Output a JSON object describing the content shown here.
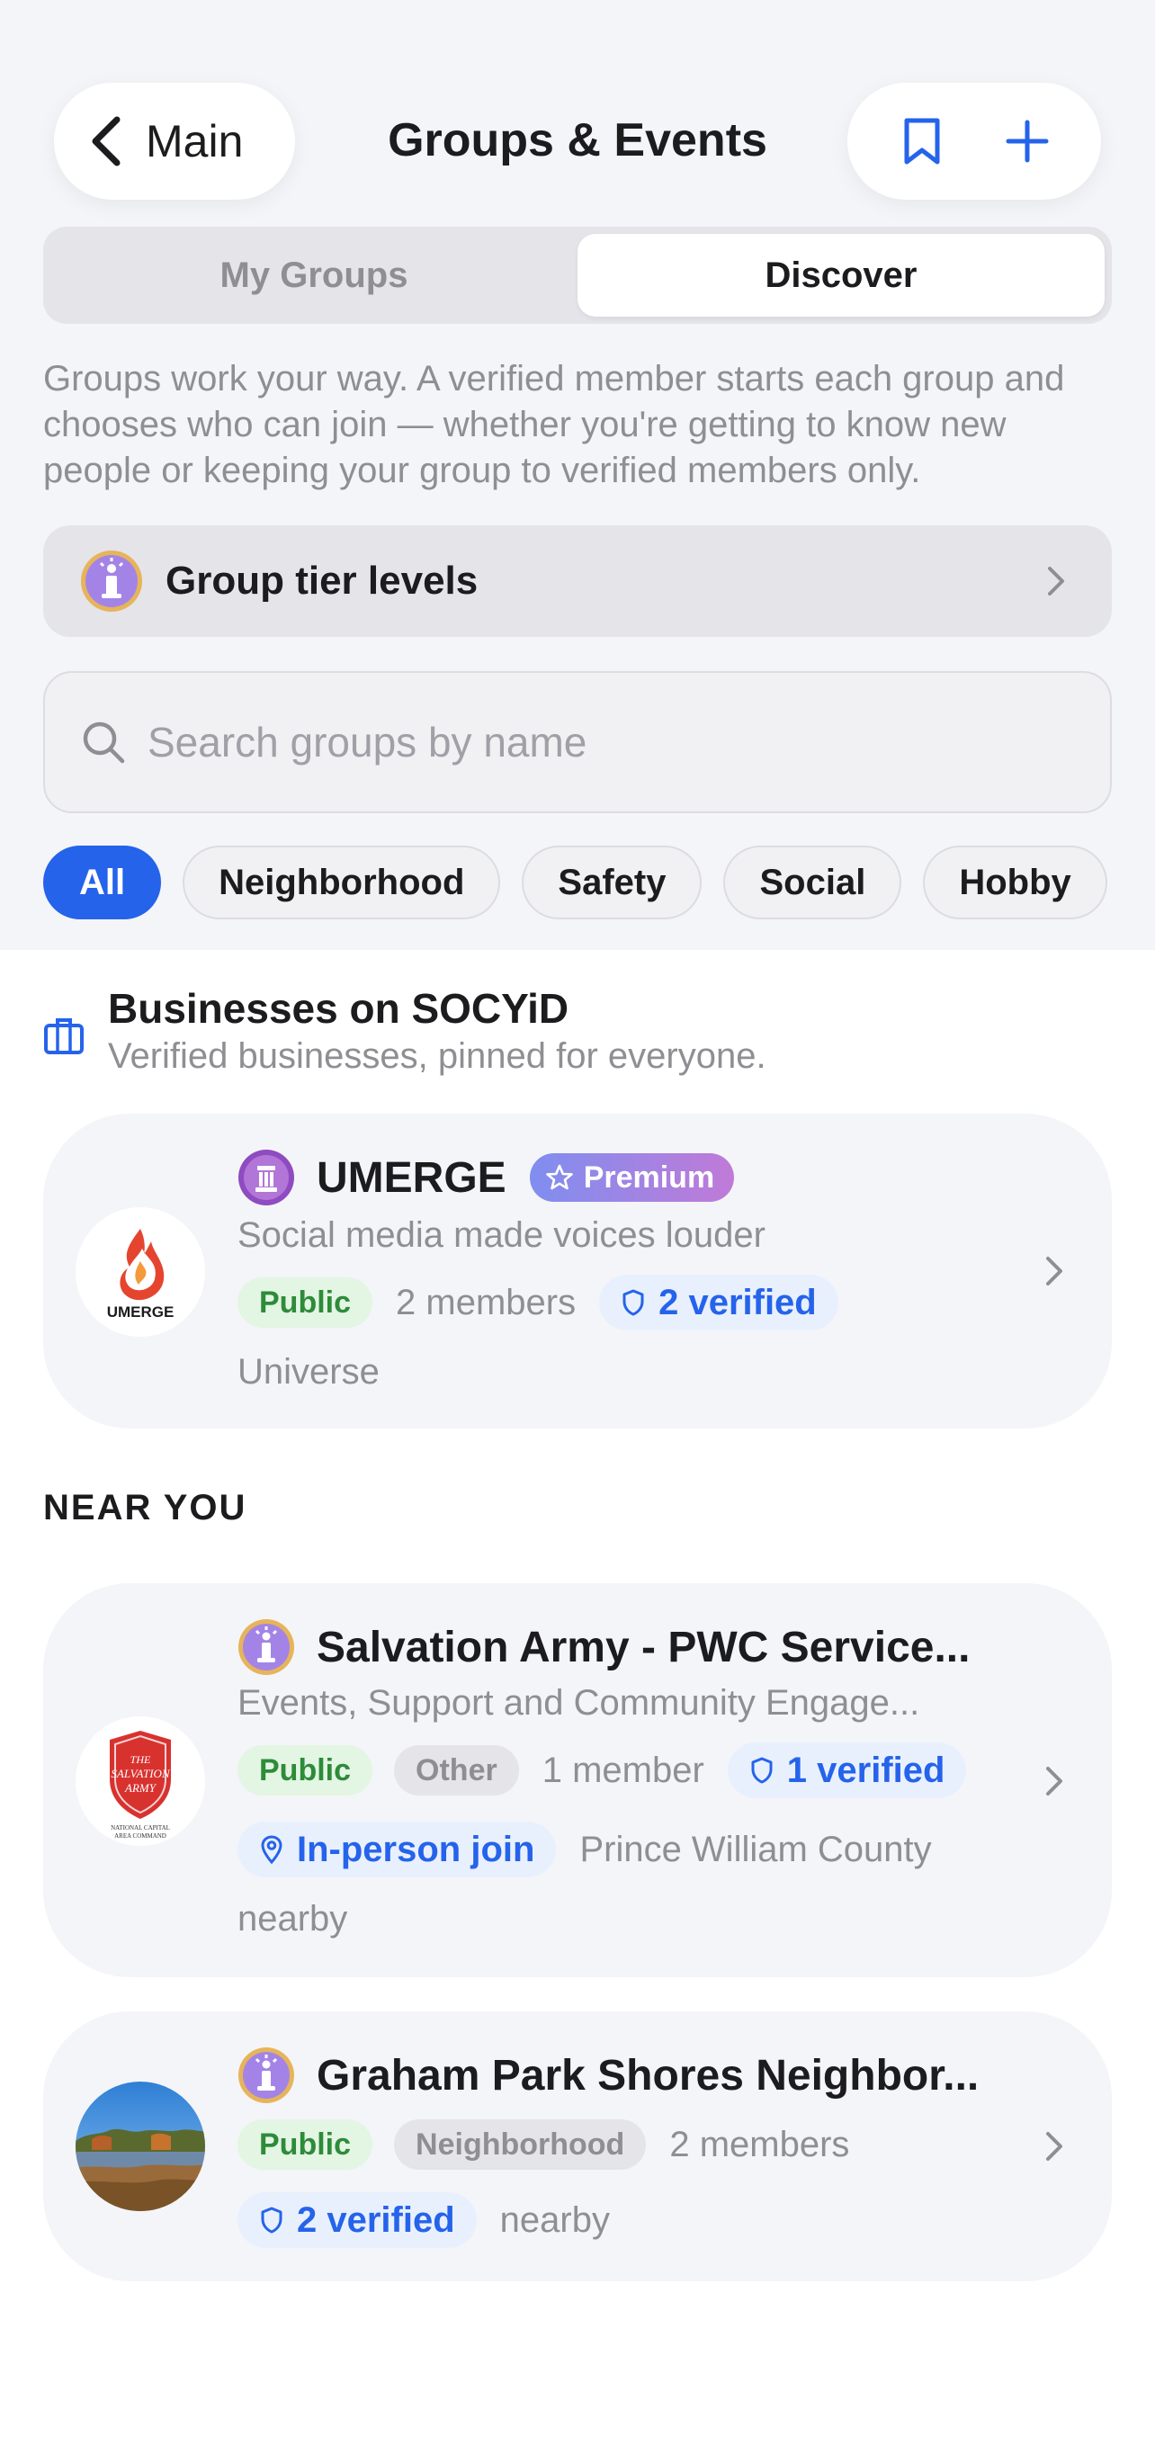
{
  "nav": {
    "back_label": "Main",
    "title": "Groups & Events",
    "icons": [
      "chevron-left-icon",
      "bookmark-icon",
      "plus-icon"
    ]
  },
  "tabs": [
    {
      "label": "My Groups",
      "active": false
    },
    {
      "label": "Discover",
      "active": true
    }
  ],
  "intro": "Groups work your way. A verified member starts each group and chooses who can join — whether you're getting to know new people or keeping your group to verified members only.",
  "tier_levels": {
    "label": "Group tier levels"
  },
  "search": {
    "placeholder": "Search groups by name",
    "value": ""
  },
  "filters": [
    {
      "label": "All",
      "active": true
    },
    {
      "label": "Neighborhood",
      "active": false
    },
    {
      "label": "Safety",
      "active": false
    },
    {
      "label": "Social",
      "active": false
    },
    {
      "label": "Hobby",
      "active": false
    }
  ],
  "businesses": {
    "title": "Businesses on SOCYiD",
    "subtitle": "Verified businesses, pinned for everyone.",
    "items": [
      {
        "name": "UMERGE",
        "badge": "Premium",
        "description": "Social media made voices louder",
        "visibility": "Public",
        "members": "2 members",
        "verified": "2 verified",
        "scope": "Universe",
        "logo_text": "UMERGE"
      }
    ]
  },
  "near_you": {
    "label": "NEAR YOU",
    "items": [
      {
        "name": "Salvation Army - PWC Service...",
        "description": "Events, Support and Community Engage...",
        "visibility": "Public",
        "category": "Other",
        "members": "1 member",
        "verified": "1 verified",
        "join": "In-person join",
        "location": "Prince William County",
        "distance": "nearby",
        "logo_text": [
          "THE",
          "SALVATION",
          "ARMY",
          "NATIONAL CAPITAL",
          "AREA COMMAND"
        ]
      },
      {
        "name": "Graham Park Shores Neighbor...",
        "visibility": "Public",
        "category": "Neighborhood",
        "members": "2 members",
        "verified": "2 verified",
        "distance": "nearby"
      }
    ]
  },
  "colors": {
    "accent": "#2563eb",
    "background": "#f4f5f8",
    "public_green": "#2e8b3a",
    "tier_purple": "#a384e6",
    "tier_gold": "#e6b45a"
  }
}
